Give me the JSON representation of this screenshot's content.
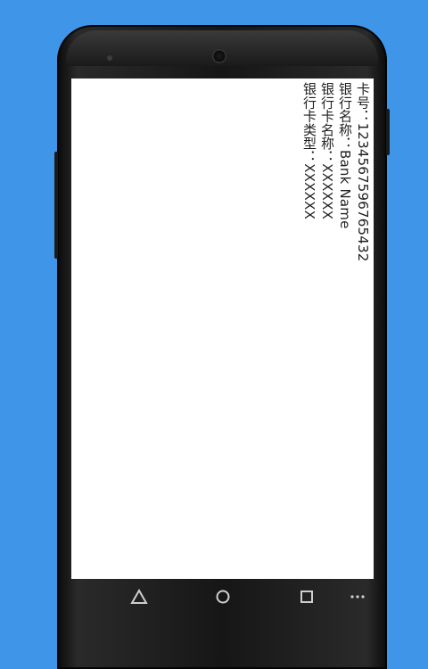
{
  "colors": {
    "background": "#3f95e8",
    "phone_body": "#161616",
    "screen": "#ffffff",
    "text": "#222222",
    "nav_icon": "#cfcfcf"
  },
  "card_info": {
    "card_number": "卡号：1234567596765432",
    "bank_name": "银行名称：Bank Name",
    "card_name": "银行卡名称：XXXXXX",
    "card_type": "银行卡类型：XXXXXX"
  },
  "nav": {
    "back_icon": "triangle-back-icon",
    "home_icon": "circle-home-icon",
    "recents_icon": "square-recents-icon",
    "menu_icon": "dots-menu-icon"
  }
}
